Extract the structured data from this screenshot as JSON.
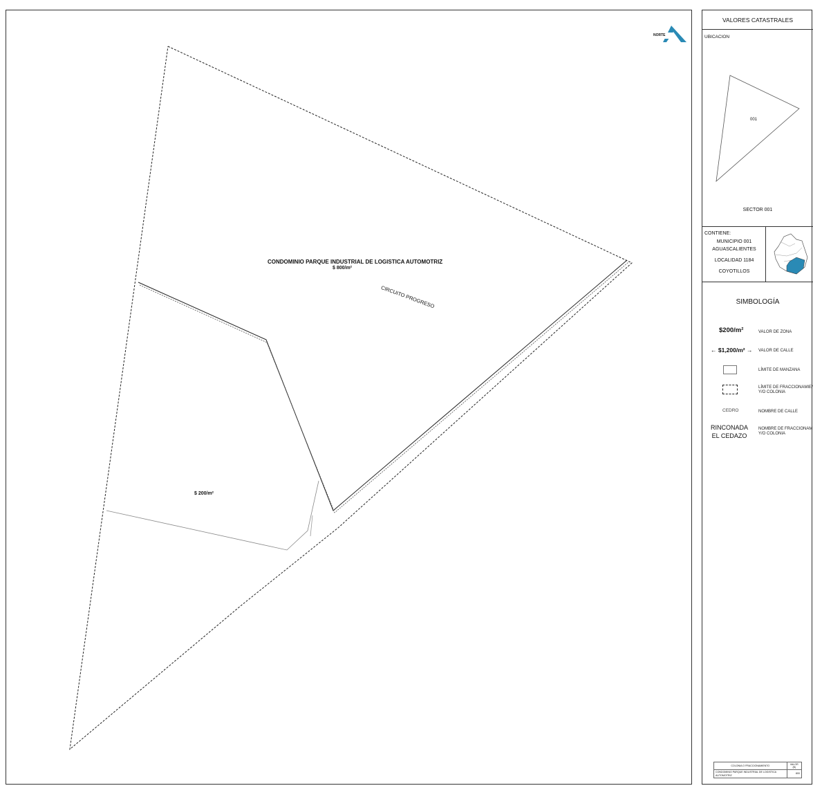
{
  "map": {
    "north_label": "NORTE",
    "condo_name": "CONDOMINIO PARQUE INDUSTRIAL DE LOGISTICA AUTOMOTRIZ",
    "condo_value": "$ 800/m²",
    "street_name": "CIRCUITO PROGRESO",
    "zone_value": "$ 200/m²",
    "colors": {
      "line": "#222222",
      "street_line": "#888888",
      "accent": "#2a8ab5"
    }
  },
  "panel": {
    "title": "VALORES CATASTRALES",
    "location_label": "UBICACION",
    "sector_marker": "001",
    "sector_label": "SECTOR 001",
    "contains_label": "CONTIENE:",
    "contains_lines": [
      "MUNICIPIO 001",
      "AGUASCALIENTES",
      "LOCALIDAD 1184",
      "COYOTILLOS"
    ],
    "legend_title": "SIMBOLOGÍA",
    "legend": {
      "zone_value_sample": "$200/m²",
      "zone_value_desc": "VALOR DE ZONA",
      "street_value_sample": "← $1,200/m² →",
      "street_value_desc": "VALOR DE CALLE",
      "block_desc": "LÍMITE DE MANZANA",
      "subdivision_desc_1": "LÍMITE DE FRACCIONAMIENTO",
      "subdivision_desc_2": "Y/O COLONIA",
      "street_name_sample": "CEDRO",
      "street_name_desc": "NOMBRE DE CALLE",
      "colony_sample_1": "RINCONADA",
      "colony_sample_2": "EL CEDAZO",
      "colony_desc_1": "NOMBRE DE FRACCIONAMIENTO",
      "colony_desc_2": "Y/O COLONIA"
    },
    "values_table": {
      "headers": [
        "COLONIA O FRACCIONAMIENTO",
        "VALOR ($)"
      ],
      "rows": [
        [
          "CONDOMINIO PARQUE INDUSTRIAL DE LOGISTICA AUTOMOTRIZ",
          "800"
        ]
      ]
    }
  }
}
